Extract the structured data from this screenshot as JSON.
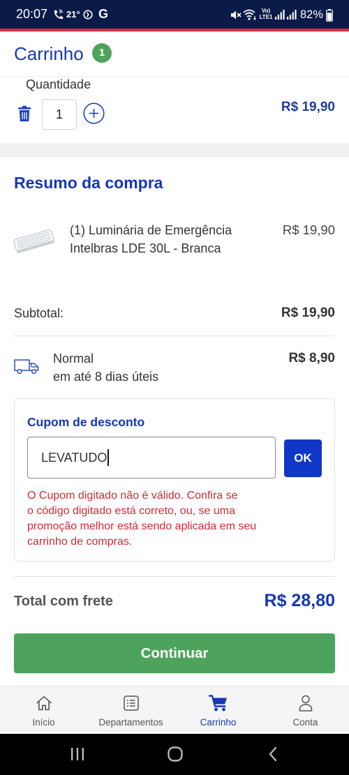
{
  "status_bar": {
    "time": "20:07",
    "temperature": "21°",
    "google": "G",
    "volte_top": "Vo)",
    "volte_bottom": "LTE1",
    "battery": "82%",
    "battery_level": 0.82,
    "left_icons": [
      "call-icon",
      "data-saver-icon",
      "google-icon"
    ],
    "right_icons": [
      "mute-icon",
      "wifi-icon",
      "volte-icon",
      "signal-sim1-icon",
      "signal-sim2-icon",
      "battery-icon"
    ]
  },
  "header": {
    "title": "Carrinho",
    "badge_count": "1"
  },
  "cart_item": {
    "quantity_label": "Quantidade",
    "quantity": "1",
    "price": "R$ 19,90",
    "icons": {
      "remove": "trash-icon",
      "increase": "plus-circle-icon"
    }
  },
  "summary": {
    "title": "Resumo da compra",
    "product": {
      "name": "(1) Luminária de Emergência Intelbras LDE 30L - Branca",
      "price": "R$ 19,90",
      "image": "emergency-light-product-image"
    },
    "subtotal_label": "Subtotal:",
    "subtotal_value": "R$ 19,90",
    "shipping": {
      "method": "Normal",
      "eta": "em até 8 dias úteis",
      "price": "R$ 8,90",
      "icon": "truck-icon"
    },
    "coupon": {
      "title": "Cupom de desconto",
      "value": "LEVATUDO",
      "button": "OK",
      "error_lines": [
        "O Cupom digitado não é válido. Confira se",
        "o código digitado está correto, ou, se uma",
        "promoção melhor está sendo aplicada em seu",
        "carrinho de compras."
      ]
    },
    "total_label": "Total com frete",
    "total_value": "R$ 28,80",
    "continue_label": "Continuar"
  },
  "bottom_nav": {
    "items": [
      {
        "label": "Início",
        "icon": "home-icon",
        "active": false
      },
      {
        "label": "Departamentos",
        "icon": "list-icon",
        "active": false
      },
      {
        "label": "Carrinho",
        "icon": "cart-icon",
        "active": true
      },
      {
        "label": "Conta",
        "icon": "user-icon",
        "active": false
      }
    ]
  },
  "system_nav": {
    "icons": [
      "recent-apps-icon",
      "home-button-icon",
      "back-icon"
    ]
  },
  "colors": {
    "brand_blue": "#1438b4",
    "accent_green": "#4ea35c",
    "error_red": "#d32a35",
    "status_bar": "#0b1b48",
    "status_stripe": "#e5283f"
  }
}
